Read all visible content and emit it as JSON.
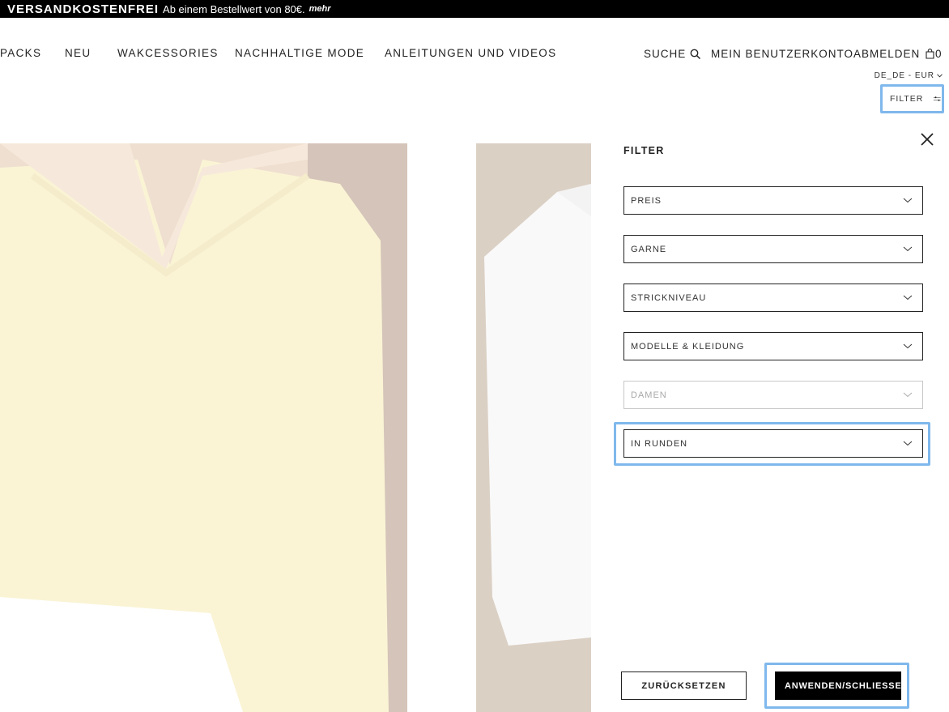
{
  "promo": {
    "bold": "VERSANDKOSTENFREI",
    "text": "Ab einem Bestellwert von 80€.",
    "more": "mehr"
  },
  "nav": {
    "items": [
      "PACKS",
      "NEU",
      "WAKCESSORIES",
      "NACHHALTIGE MODE",
      "ANLEITUNGEN UND VIDEOS"
    ]
  },
  "utility": {
    "search": "SUCHE",
    "account": "MEIN BENUTZERKONTO",
    "logout": "ABMELDEN",
    "cart_count": "0",
    "locale": "DE_DE - EUR"
  },
  "filter_toggle": {
    "label": "FILTER"
  },
  "filter_panel": {
    "title": "FILTER",
    "dropdowns": [
      {
        "label": "PREIS",
        "state": "enabled"
      },
      {
        "label": "GARNE",
        "state": "enabled"
      },
      {
        "label": "STRICKNIVEAU",
        "state": "enabled"
      },
      {
        "label": "MODELLE & KLEIDUNG",
        "state": "enabled"
      },
      {
        "label": "DAMEN",
        "state": "disabled"
      },
      {
        "label": "IN RUNDEN",
        "state": "enabled"
      }
    ],
    "reset_label": "ZURÜCKSETZEN",
    "apply_label": "ANWENDEN/SCHLIESSEN"
  },
  "colors": {
    "accent_highlight": "#7fb8ec",
    "promo_bg": "#000000",
    "product_1_tone": "#f3e08a",
    "product_2_tone": "#eeeeee"
  }
}
